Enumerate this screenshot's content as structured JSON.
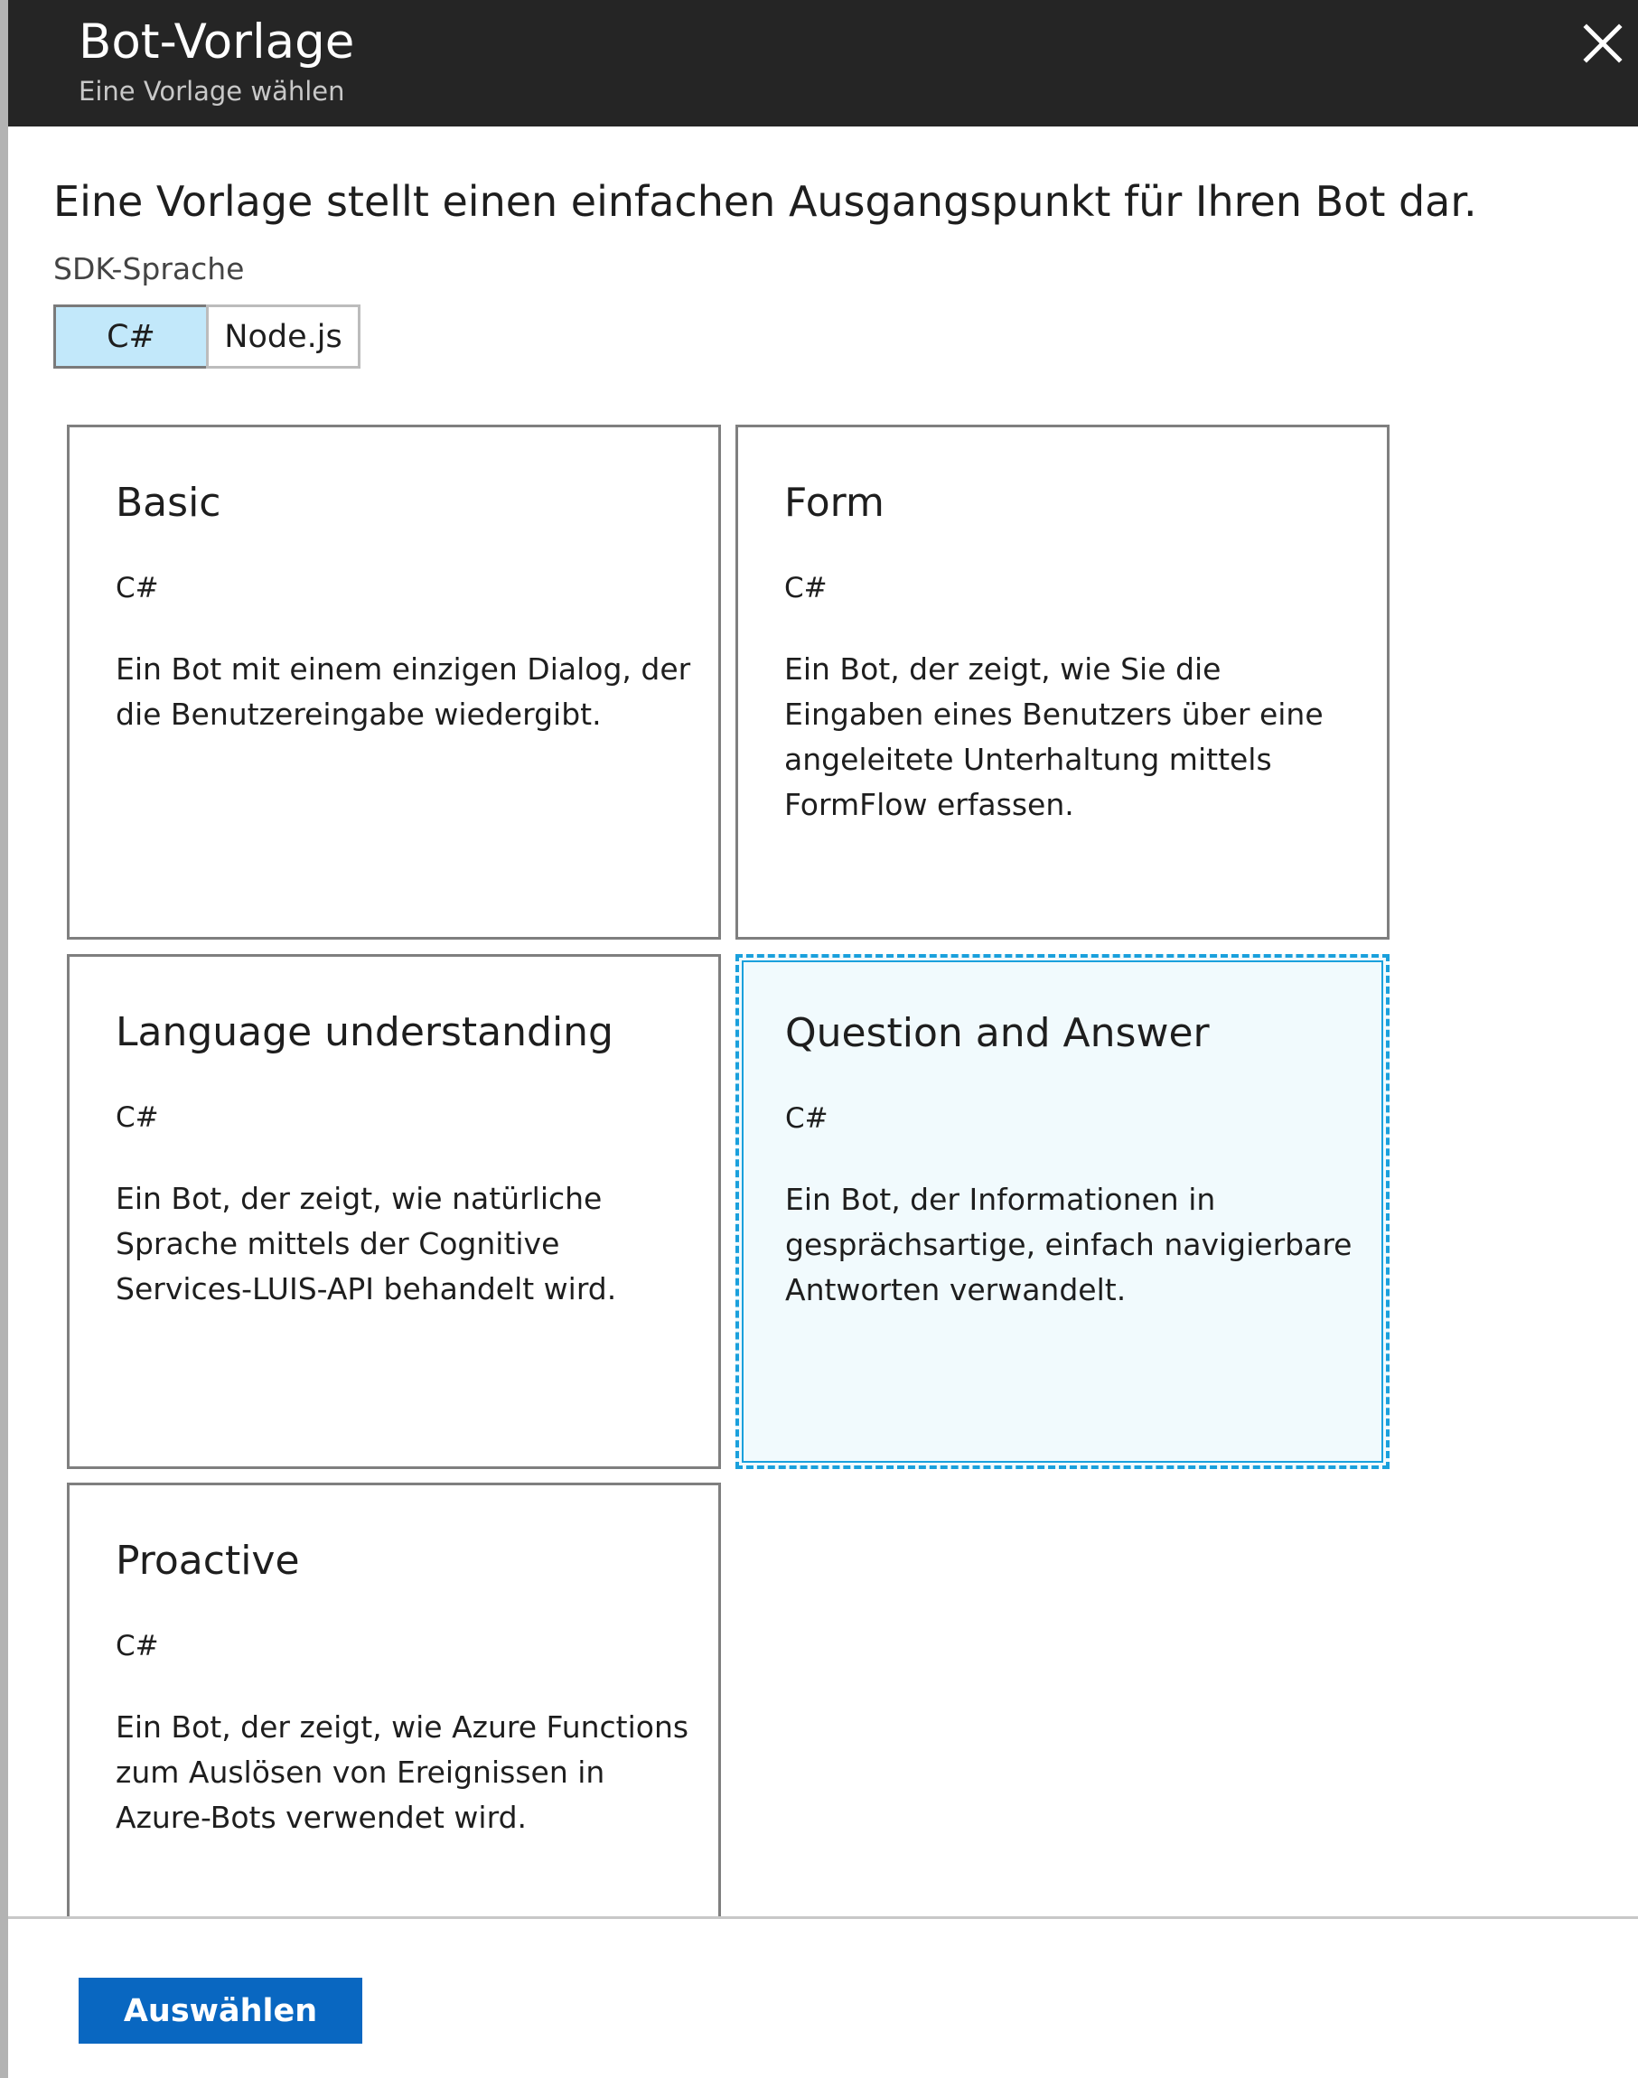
{
  "header": {
    "title": "Bot-Vorlage",
    "subtitle": "Eine Vorlage wählen",
    "close_icon": "close-icon"
  },
  "intro": {
    "text": "Eine Vorlage stellt einen einfachen Ausgangspunkt für Ihren Bot dar.",
    "sdk_label": "SDK-Sprache"
  },
  "sdk_options": {
    "csharp": "C#",
    "nodejs": "Node.js",
    "selected": "C#"
  },
  "templates": [
    {
      "title": "Basic",
      "language": "C#",
      "description": "Ein Bot mit einem einzigen Dialog, der die Benutzereingabe wiedergibt."
    },
    {
      "title": "Form",
      "language": "C#",
      "description": "Ein Bot, der zeigt, wie Sie die Eingaben eines Benutzers über eine angeleitete Unterhaltung mittels FormFlow erfassen."
    },
    {
      "title": "Language understanding",
      "language": "C#",
      "description": "Ein Bot, der zeigt, wie natürliche Sprache mittels der Cognitive Services-LUIS-API behandelt wird."
    },
    {
      "title": "Question and Answer",
      "language": "C#",
      "description": "Ein Bot, der Informationen in gesprächsartige, einfach navigierbare Antworten verwandelt."
    },
    {
      "title": "Proactive",
      "language": "C#",
      "description": "Ein Bot, der zeigt, wie Azure Functions zum Auslösen von Ereignissen in Azure-Bots verwendet wird."
    }
  ],
  "selected_template": "Question and Answer",
  "footer": {
    "select_button": "Auswählen"
  },
  "colors": {
    "header_bg": "#252525",
    "toggle_selected": "#c2e8fa",
    "card_selected_bg": "#f1fafd",
    "card_selected_border": "#1aa0dc",
    "primary_button": "#0967c1"
  }
}
